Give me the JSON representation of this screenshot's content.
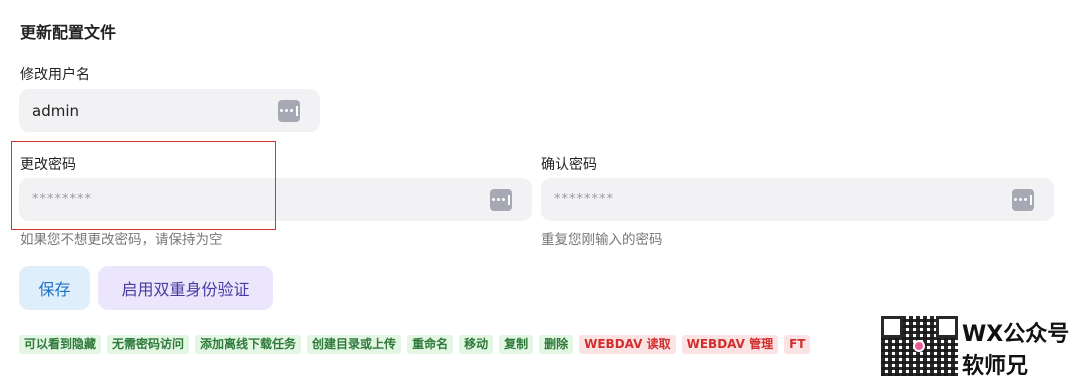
{
  "section": {
    "title": "更新配置文件"
  },
  "username": {
    "label": "修改用户名",
    "value": "admin"
  },
  "password": {
    "label": "更改密码",
    "placeholder": "********",
    "hint": "如果您不想更改密码，请保持为空"
  },
  "confirm": {
    "label": "确认密码",
    "placeholder": "********",
    "hint": "重复您刚输入的密码"
  },
  "buttons": {
    "save": "保存",
    "enable_2fa": "启用双重身份验证"
  },
  "permissions": [
    {
      "label": "可以看到隐藏",
      "status": "granted"
    },
    {
      "label": "无需密码访问",
      "status": "granted"
    },
    {
      "label": "添加离线下载任务",
      "status": "granted"
    },
    {
      "label": "创建目录或上传",
      "status": "granted"
    },
    {
      "label": "重命名",
      "status": "granted"
    },
    {
      "label": "移动",
      "status": "granted"
    },
    {
      "label": "复制",
      "status": "granted"
    },
    {
      "label": "删除",
      "status": "granted"
    },
    {
      "label": "WEBDAV 读取",
      "status": "denied"
    },
    {
      "label": "WEBDAV 管理",
      "status": "denied"
    },
    {
      "label": "FT",
      "status": "denied"
    }
  ],
  "watermark": {
    "line1": "WX公众号",
    "line2": "软师兄"
  },
  "colors": {
    "granted_text": "#2d7a3a",
    "granted_bg": "#e3f5e3",
    "denied_text": "#d12e2e",
    "denied_bg": "#fbe3e3",
    "highlight": "#d9342b"
  }
}
